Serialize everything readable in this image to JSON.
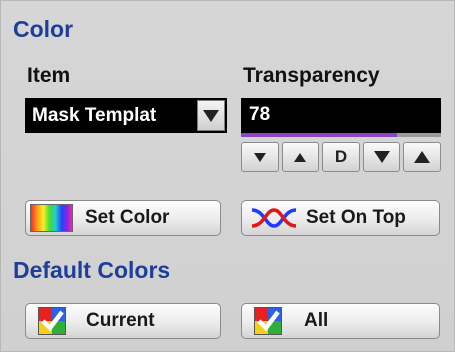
{
  "color_section": {
    "title": "Color",
    "item_label": "Item",
    "item_value": "Mask Templat",
    "transparency_label": "Transparency",
    "transparency_value": "78",
    "transparency_level_percent": 78,
    "stepper": {
      "down_small_icon": "triangle-down-icon",
      "up_small_icon": "triangle-up-icon",
      "default_label": "D",
      "down_large_icon": "triangle-down-icon",
      "up_large_icon": "triangle-up-icon"
    },
    "set_color_label": "Set Color",
    "set_color_icon": "rainbow-swatch-icon",
    "set_on_top_label": "Set On Top",
    "set_on_top_icon": "crossing-waves-icon"
  },
  "default_colors_section": {
    "title": "Default Colors",
    "current_label": "Current",
    "current_icon": "color-check-icon",
    "all_label": "All",
    "all_icon": "color-check-icon"
  },
  "colors": {
    "section_title": "#1d3f9a",
    "slider_fill": "#8a46c8",
    "wave_blue": "#1e3cff",
    "wave_red": "#e01818"
  }
}
